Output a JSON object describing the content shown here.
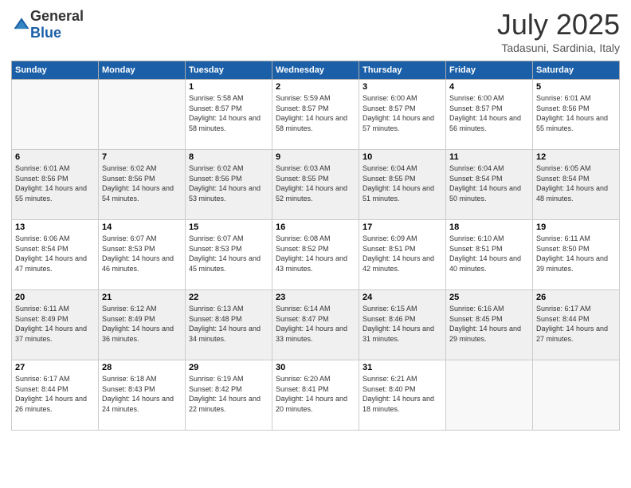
{
  "logo": {
    "general": "General",
    "blue": "Blue"
  },
  "header": {
    "month": "July 2025",
    "location": "Tadasuni, Sardinia, Italy"
  },
  "weekdays": [
    "Sunday",
    "Monday",
    "Tuesday",
    "Wednesday",
    "Thursday",
    "Friday",
    "Saturday"
  ],
  "weeks": [
    [
      {
        "day": "",
        "info": ""
      },
      {
        "day": "",
        "info": ""
      },
      {
        "day": "1",
        "info": "Sunrise: 5:58 AM\nSunset: 8:57 PM\nDaylight: 14 hours and 58 minutes."
      },
      {
        "day": "2",
        "info": "Sunrise: 5:59 AM\nSunset: 8:57 PM\nDaylight: 14 hours and 58 minutes."
      },
      {
        "day": "3",
        "info": "Sunrise: 6:00 AM\nSunset: 8:57 PM\nDaylight: 14 hours and 57 minutes."
      },
      {
        "day": "4",
        "info": "Sunrise: 6:00 AM\nSunset: 8:57 PM\nDaylight: 14 hours and 56 minutes."
      },
      {
        "day": "5",
        "info": "Sunrise: 6:01 AM\nSunset: 8:56 PM\nDaylight: 14 hours and 55 minutes."
      }
    ],
    [
      {
        "day": "6",
        "info": "Sunrise: 6:01 AM\nSunset: 8:56 PM\nDaylight: 14 hours and 55 minutes."
      },
      {
        "day": "7",
        "info": "Sunrise: 6:02 AM\nSunset: 8:56 PM\nDaylight: 14 hours and 54 minutes."
      },
      {
        "day": "8",
        "info": "Sunrise: 6:02 AM\nSunset: 8:56 PM\nDaylight: 14 hours and 53 minutes."
      },
      {
        "day": "9",
        "info": "Sunrise: 6:03 AM\nSunset: 8:55 PM\nDaylight: 14 hours and 52 minutes."
      },
      {
        "day": "10",
        "info": "Sunrise: 6:04 AM\nSunset: 8:55 PM\nDaylight: 14 hours and 51 minutes."
      },
      {
        "day": "11",
        "info": "Sunrise: 6:04 AM\nSunset: 8:54 PM\nDaylight: 14 hours and 50 minutes."
      },
      {
        "day": "12",
        "info": "Sunrise: 6:05 AM\nSunset: 8:54 PM\nDaylight: 14 hours and 48 minutes."
      }
    ],
    [
      {
        "day": "13",
        "info": "Sunrise: 6:06 AM\nSunset: 8:54 PM\nDaylight: 14 hours and 47 minutes."
      },
      {
        "day": "14",
        "info": "Sunrise: 6:07 AM\nSunset: 8:53 PM\nDaylight: 14 hours and 46 minutes."
      },
      {
        "day": "15",
        "info": "Sunrise: 6:07 AM\nSunset: 8:53 PM\nDaylight: 14 hours and 45 minutes."
      },
      {
        "day": "16",
        "info": "Sunrise: 6:08 AM\nSunset: 8:52 PM\nDaylight: 14 hours and 43 minutes."
      },
      {
        "day": "17",
        "info": "Sunrise: 6:09 AM\nSunset: 8:51 PM\nDaylight: 14 hours and 42 minutes."
      },
      {
        "day": "18",
        "info": "Sunrise: 6:10 AM\nSunset: 8:51 PM\nDaylight: 14 hours and 40 minutes."
      },
      {
        "day": "19",
        "info": "Sunrise: 6:11 AM\nSunset: 8:50 PM\nDaylight: 14 hours and 39 minutes."
      }
    ],
    [
      {
        "day": "20",
        "info": "Sunrise: 6:11 AM\nSunset: 8:49 PM\nDaylight: 14 hours and 37 minutes."
      },
      {
        "day": "21",
        "info": "Sunrise: 6:12 AM\nSunset: 8:49 PM\nDaylight: 14 hours and 36 minutes."
      },
      {
        "day": "22",
        "info": "Sunrise: 6:13 AM\nSunset: 8:48 PM\nDaylight: 14 hours and 34 minutes."
      },
      {
        "day": "23",
        "info": "Sunrise: 6:14 AM\nSunset: 8:47 PM\nDaylight: 14 hours and 33 minutes."
      },
      {
        "day": "24",
        "info": "Sunrise: 6:15 AM\nSunset: 8:46 PM\nDaylight: 14 hours and 31 minutes."
      },
      {
        "day": "25",
        "info": "Sunrise: 6:16 AM\nSunset: 8:45 PM\nDaylight: 14 hours and 29 minutes."
      },
      {
        "day": "26",
        "info": "Sunrise: 6:17 AM\nSunset: 8:44 PM\nDaylight: 14 hours and 27 minutes."
      }
    ],
    [
      {
        "day": "27",
        "info": "Sunrise: 6:17 AM\nSunset: 8:44 PM\nDaylight: 14 hours and 26 minutes."
      },
      {
        "day": "28",
        "info": "Sunrise: 6:18 AM\nSunset: 8:43 PM\nDaylight: 14 hours and 24 minutes."
      },
      {
        "day": "29",
        "info": "Sunrise: 6:19 AM\nSunset: 8:42 PM\nDaylight: 14 hours and 22 minutes."
      },
      {
        "day": "30",
        "info": "Sunrise: 6:20 AM\nSunset: 8:41 PM\nDaylight: 14 hours and 20 minutes."
      },
      {
        "day": "31",
        "info": "Sunrise: 6:21 AM\nSunset: 8:40 PM\nDaylight: 14 hours and 18 minutes."
      },
      {
        "day": "",
        "info": ""
      },
      {
        "day": "",
        "info": ""
      }
    ]
  ]
}
